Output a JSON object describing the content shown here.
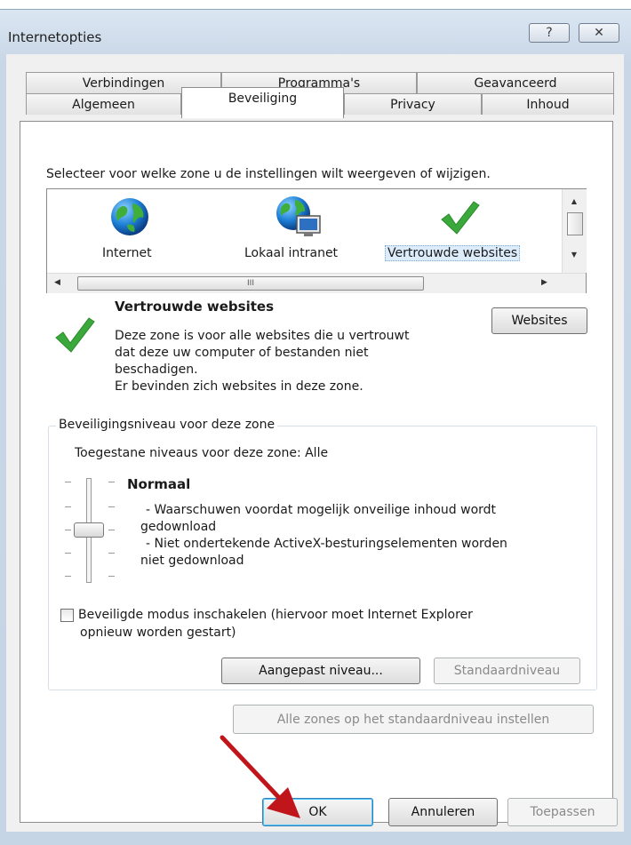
{
  "window": {
    "title": "Internetopties",
    "help_glyph": "?",
    "close_glyph": "✕"
  },
  "tabs_back": [
    "Verbindingen",
    "Programma's",
    "Geavanceerd"
  ],
  "tabs_front": [
    "Algemeen",
    "Beveiliging",
    "Privacy",
    "Inhoud"
  ],
  "active_tab": "Beveiliging",
  "zones": {
    "prompt": "Selecteer voor welke zone u de instellingen wilt weergeven of wijzigen.",
    "items": [
      {
        "label": "Internet",
        "icon": "globe-icon"
      },
      {
        "label": "Lokaal intranet",
        "icon": "intranet-globe-icon"
      },
      {
        "label": "Vertrouwde websites",
        "icon": "checkmark-icon",
        "selected": true
      }
    ],
    "scroll_thumb_glyph": "III"
  },
  "zone_info": {
    "title": "Vertrouwde websites",
    "description_lines": [
      "Deze zone is voor alle websites die u vertrouwt",
      "dat deze uw computer of bestanden niet",
      "beschadigen.",
      "Er bevinden zich websites in deze zone."
    ],
    "websites_button": "Websites"
  },
  "security_level": {
    "group_title": "Beveiligingsniveau voor deze zone",
    "allowed_levels": "Toegestane niveaus voor deze zone: Alle",
    "level_name": "Normaal",
    "level_lines": [
      "- Waarschuwen voordat mogelijk onveilige inhoud wordt",
      "gedownload",
      "- Niet ondertekende ActiveX-besturingselementen worden",
      "niet gedownload"
    ],
    "protected_mode_line1": "Beveiligde modus inschakelen (hiervoor moet Internet Explorer",
    "protected_mode_line2": "opnieuw worden gestart)",
    "protected_mode_checked": false,
    "custom_level_button": "Aangepast niveau...",
    "default_level_button": "Standaardniveau"
  },
  "reset_all_button": "Alle zones op het standaardniveau instellen",
  "footer": {
    "ok": "OK",
    "cancel": "Annuleren",
    "apply": "Toepassen"
  },
  "colors": {
    "annotation_arrow": "#c0161b",
    "check_green": "#3aa83a"
  }
}
